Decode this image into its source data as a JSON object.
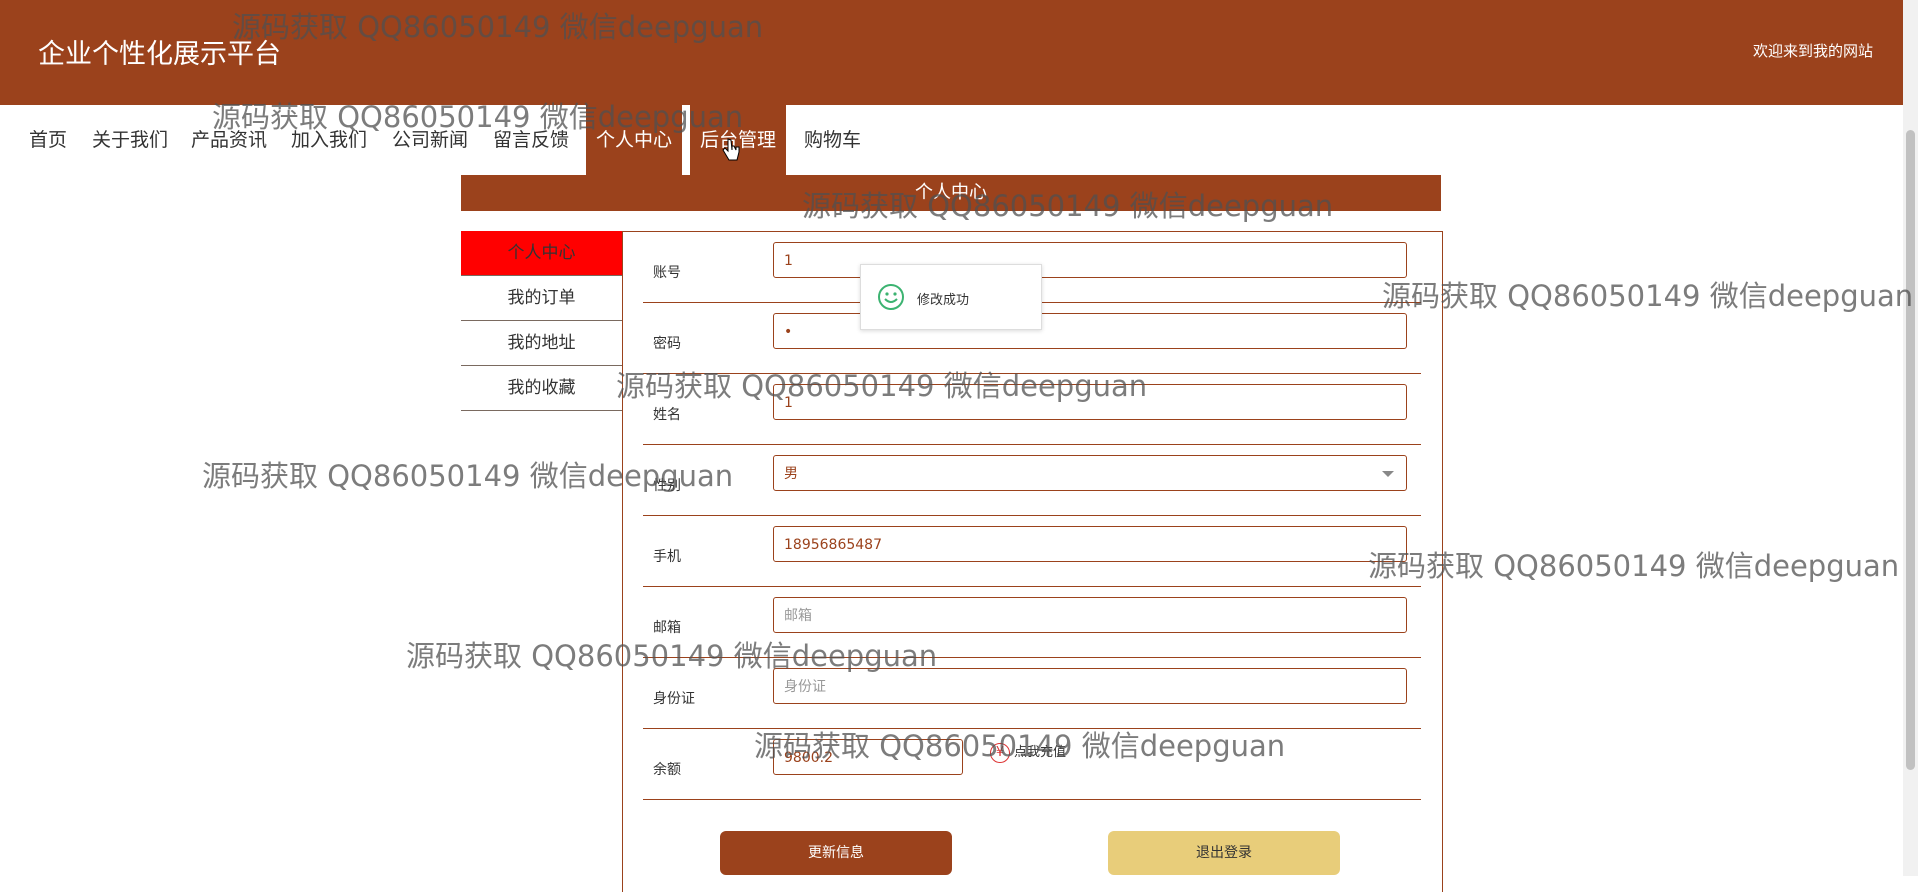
{
  "header": {
    "title": "企业个性化展示平台",
    "welcome": "欢迎来到我的网站"
  },
  "nav": [
    {
      "label": "首页"
    },
    {
      "label": "关于我们"
    },
    {
      "label": "产品资讯"
    },
    {
      "label": "加入我们"
    },
    {
      "label": "公司新闻"
    },
    {
      "label": "留言反馈"
    },
    {
      "label": "个人中心",
      "active": true
    },
    {
      "label": "后台管理"
    },
    {
      "label": "购物车"
    }
  ],
  "section_title": "个人中心",
  "sidebar": [
    {
      "label": "个人中心",
      "active": true
    },
    {
      "label": "我的订单"
    },
    {
      "label": "我的地址"
    },
    {
      "label": "我的收藏"
    }
  ],
  "form": {
    "account": {
      "label": "账号",
      "value": "1"
    },
    "password": {
      "label": "密码",
      "value": "•"
    },
    "name": {
      "label": "姓名",
      "value": "1"
    },
    "gender": {
      "label": "性别",
      "value": "男"
    },
    "phone": {
      "label": "手机",
      "value": "18956865487"
    },
    "email": {
      "label": "邮箱",
      "placeholder": "邮箱"
    },
    "idcard": {
      "label": "身份证",
      "placeholder": "身份证"
    },
    "balance": {
      "label": "余额",
      "value": "9800.2"
    },
    "recharge": {
      "label": "点我充值",
      "icon": "yen-icon",
      "symbol": "¥"
    }
  },
  "buttons": {
    "update": "更新信息",
    "logout": "退出登录"
  },
  "toast": {
    "message": "修改成功",
    "icon": "smile-icon"
  },
  "watermark": "源码获取 QQ86050149 微信deepguan",
  "colors": {
    "brand": "#9b421c",
    "active_sidebar": "#ff0000",
    "logout_button": "#e8cd7a"
  }
}
